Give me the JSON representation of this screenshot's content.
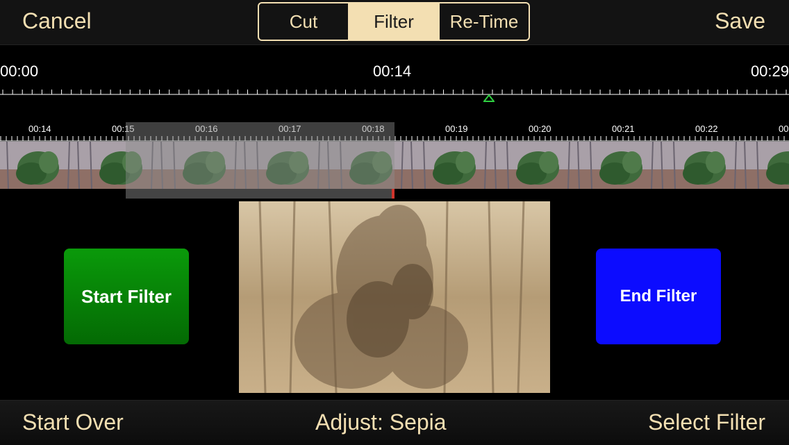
{
  "header": {
    "cancel_label": "Cancel",
    "save_label": "Save",
    "tabs": [
      {
        "label": "Cut",
        "active": false
      },
      {
        "label": "Filter",
        "active": true
      },
      {
        "label": "Re-Time",
        "active": false
      }
    ]
  },
  "overview": {
    "start_time": "00:00",
    "mid_time": "00:14",
    "end_time": "00:29"
  },
  "filmstrip": {
    "times": [
      "00:14",
      "00:15",
      "00:16",
      "00:17",
      "00:18",
      "00:19",
      "00:20",
      "00:21",
      "00:22",
      "00:"
    ]
  },
  "controls": {
    "start_filter_label": "Start Filter",
    "end_filter_label": "End Filter"
  },
  "footer": {
    "start_over_label": "Start Over",
    "adjust_label": "Adjust: Sepia",
    "select_filter_label": "Select Filter"
  },
  "colors": {
    "accent": "#f3dfb2",
    "start_button": "#0a8f0a",
    "end_button": "#0c0cff",
    "playhead": "#2ecc40",
    "selection_marker": "#d0342c"
  }
}
